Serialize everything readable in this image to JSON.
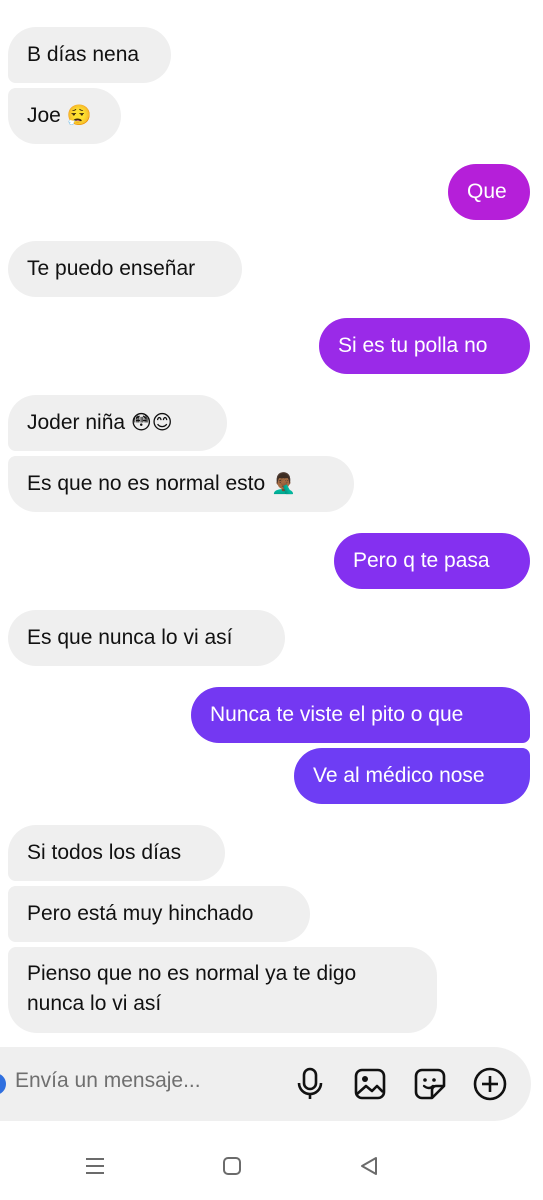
{
  "messages": [
    {
      "text": "B días nena",
      "emoji": ""
    },
    {
      "text": "Joe ",
      "emoji": "😮‍💨"
    },
    {
      "text": "Que",
      "emoji": ""
    },
    {
      "text": "Te puedo enseñar",
      "emoji": ""
    },
    {
      "text": "Si es tu polla no",
      "emoji": ""
    },
    {
      "text": "Joder niña ",
      "emoji": "😳😊"
    },
    {
      "text": "Es que no es normal esto ",
      "emoji": "🤦🏾‍♂️"
    },
    {
      "text": "Pero q te pasa",
      "emoji": ""
    },
    {
      "text": "Es que nunca lo vi  así",
      "emoji": ""
    },
    {
      "text": "Nunca te viste el pito o que",
      "emoji": ""
    },
    {
      "text": "Ve al médico nose",
      "emoji": ""
    },
    {
      "text": "Si todos los días",
      "emoji": ""
    },
    {
      "text": "Pero está muy hinchado",
      "emoji": ""
    },
    {
      "text": "Pienso que no es normal ya te digo nunca lo vi así",
      "emoji": ""
    }
  ],
  "composer": {
    "placeholder": "Envía un mensaje...",
    "icons": [
      "microphone-icon",
      "image-icon",
      "sticker-icon",
      "plus-circle-icon"
    ]
  },
  "navigation": {
    "icons": [
      "recents-icon",
      "home-icon",
      "back-icon"
    ]
  },
  "colors": {
    "incoming_bubble": "#efefef",
    "outgoing_top": "#b51fd9",
    "outgoing_mid": "#8e2cf0",
    "outgoing_bottom": "#6d3ff5",
    "composer_bg": "#efefef"
  }
}
